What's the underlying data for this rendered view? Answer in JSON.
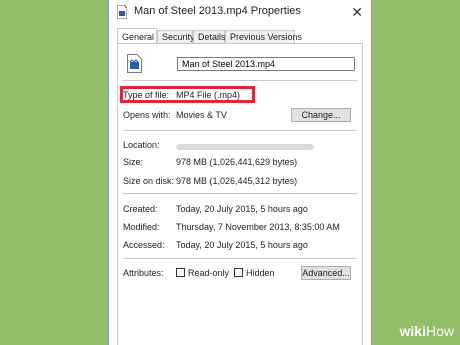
{
  "window": {
    "title": "Man of Steel 2013.mp4 Properties",
    "close_symbol": "✕"
  },
  "tabs": [
    {
      "label": "General",
      "active": true
    },
    {
      "label": "Security",
      "active": false
    },
    {
      "label": "Details",
      "active": false
    },
    {
      "label": "Previous Versions",
      "active": false
    }
  ],
  "file_name": "Man of Steel 2013.mp4",
  "properties": {
    "type_label": "Type of file:",
    "type_value": "MP4 File (.mp4)",
    "opens_label": "Opens with:",
    "opens_value": "Movies & TV",
    "change_button": "Change...",
    "location_label": "Location:",
    "size_label": "Size:",
    "size_value": "978 MB (1,026,441,629 bytes)",
    "size_on_disk_label": "Size on disk:",
    "size_on_disk_value": "978 MB (1,026,445,312 bytes)",
    "created_label": "Created:",
    "created_value": "Today, 20 July 2015, 5 hours ago",
    "modified_label": "Modified:",
    "modified_value": "Thursday, 7 November 2013, 8:35:00 AM",
    "accessed_label": "Accessed:",
    "accessed_value": "Today, 20 July 2015, 5 hours ago",
    "attributes_label": "Attributes:",
    "readonly_label": "Read-only",
    "hidden_label": "Hidden",
    "advanced_button": "Advanced..."
  },
  "watermark": {
    "wiki": "wiki",
    "how": "How"
  },
  "colors": {
    "highlight": "#e32636",
    "background": "#93bd67"
  }
}
